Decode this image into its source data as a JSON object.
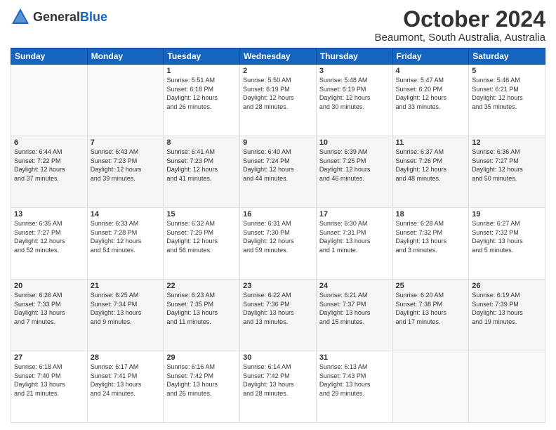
{
  "header": {
    "logo_general": "General",
    "logo_blue": "Blue",
    "title": "October 2024",
    "subtitle": "Beaumont, South Australia, Australia"
  },
  "days_of_week": [
    "Sunday",
    "Monday",
    "Tuesday",
    "Wednesday",
    "Thursday",
    "Friday",
    "Saturday"
  ],
  "weeks": [
    [
      {
        "day": "",
        "info": ""
      },
      {
        "day": "",
        "info": ""
      },
      {
        "day": "1",
        "info": "Sunrise: 5:51 AM\nSunset: 6:18 PM\nDaylight: 12 hours\nand 26 minutes."
      },
      {
        "day": "2",
        "info": "Sunrise: 5:50 AM\nSunset: 6:19 PM\nDaylight: 12 hours\nand 28 minutes."
      },
      {
        "day": "3",
        "info": "Sunrise: 5:48 AM\nSunset: 6:19 PM\nDaylight: 12 hours\nand 30 minutes."
      },
      {
        "day": "4",
        "info": "Sunrise: 5:47 AM\nSunset: 6:20 PM\nDaylight: 12 hours\nand 33 minutes."
      },
      {
        "day": "5",
        "info": "Sunrise: 5:46 AM\nSunset: 6:21 PM\nDaylight: 12 hours\nand 35 minutes."
      }
    ],
    [
      {
        "day": "6",
        "info": "Sunrise: 6:44 AM\nSunset: 7:22 PM\nDaylight: 12 hours\nand 37 minutes."
      },
      {
        "day": "7",
        "info": "Sunrise: 6:43 AM\nSunset: 7:23 PM\nDaylight: 12 hours\nand 39 minutes."
      },
      {
        "day": "8",
        "info": "Sunrise: 6:41 AM\nSunset: 7:23 PM\nDaylight: 12 hours\nand 41 minutes."
      },
      {
        "day": "9",
        "info": "Sunrise: 6:40 AM\nSunset: 7:24 PM\nDaylight: 12 hours\nand 44 minutes."
      },
      {
        "day": "10",
        "info": "Sunrise: 6:39 AM\nSunset: 7:25 PM\nDaylight: 12 hours\nand 46 minutes."
      },
      {
        "day": "11",
        "info": "Sunrise: 6:37 AM\nSunset: 7:26 PM\nDaylight: 12 hours\nand 48 minutes."
      },
      {
        "day": "12",
        "info": "Sunrise: 6:36 AM\nSunset: 7:27 PM\nDaylight: 12 hours\nand 50 minutes."
      }
    ],
    [
      {
        "day": "13",
        "info": "Sunrise: 6:35 AM\nSunset: 7:27 PM\nDaylight: 12 hours\nand 52 minutes."
      },
      {
        "day": "14",
        "info": "Sunrise: 6:33 AM\nSunset: 7:28 PM\nDaylight: 12 hours\nand 54 minutes."
      },
      {
        "day": "15",
        "info": "Sunrise: 6:32 AM\nSunset: 7:29 PM\nDaylight: 12 hours\nand 56 minutes."
      },
      {
        "day": "16",
        "info": "Sunrise: 6:31 AM\nSunset: 7:30 PM\nDaylight: 12 hours\nand 59 minutes."
      },
      {
        "day": "17",
        "info": "Sunrise: 6:30 AM\nSunset: 7:31 PM\nDaylight: 13 hours\nand 1 minute."
      },
      {
        "day": "18",
        "info": "Sunrise: 6:28 AM\nSunset: 7:32 PM\nDaylight: 13 hours\nand 3 minutes."
      },
      {
        "day": "19",
        "info": "Sunrise: 6:27 AM\nSunset: 7:32 PM\nDaylight: 13 hours\nand 5 minutes."
      }
    ],
    [
      {
        "day": "20",
        "info": "Sunrise: 6:26 AM\nSunset: 7:33 PM\nDaylight: 13 hours\nand 7 minutes."
      },
      {
        "day": "21",
        "info": "Sunrise: 6:25 AM\nSunset: 7:34 PM\nDaylight: 13 hours\nand 9 minutes."
      },
      {
        "day": "22",
        "info": "Sunrise: 6:23 AM\nSunset: 7:35 PM\nDaylight: 13 hours\nand 11 minutes."
      },
      {
        "day": "23",
        "info": "Sunrise: 6:22 AM\nSunset: 7:36 PM\nDaylight: 13 hours\nand 13 minutes."
      },
      {
        "day": "24",
        "info": "Sunrise: 6:21 AM\nSunset: 7:37 PM\nDaylight: 13 hours\nand 15 minutes."
      },
      {
        "day": "25",
        "info": "Sunrise: 6:20 AM\nSunset: 7:38 PM\nDaylight: 13 hours\nand 17 minutes."
      },
      {
        "day": "26",
        "info": "Sunrise: 6:19 AM\nSunset: 7:39 PM\nDaylight: 13 hours\nand 19 minutes."
      }
    ],
    [
      {
        "day": "27",
        "info": "Sunrise: 6:18 AM\nSunset: 7:40 PM\nDaylight: 13 hours\nand 21 minutes."
      },
      {
        "day": "28",
        "info": "Sunrise: 6:17 AM\nSunset: 7:41 PM\nDaylight: 13 hours\nand 24 minutes."
      },
      {
        "day": "29",
        "info": "Sunrise: 6:16 AM\nSunset: 7:42 PM\nDaylight: 13 hours\nand 26 minutes."
      },
      {
        "day": "30",
        "info": "Sunrise: 6:14 AM\nSunset: 7:42 PM\nDaylight: 13 hours\nand 28 minutes."
      },
      {
        "day": "31",
        "info": "Sunrise: 6:13 AM\nSunset: 7:43 PM\nDaylight: 13 hours\nand 29 minutes."
      },
      {
        "day": "",
        "info": ""
      },
      {
        "day": "",
        "info": ""
      }
    ]
  ]
}
